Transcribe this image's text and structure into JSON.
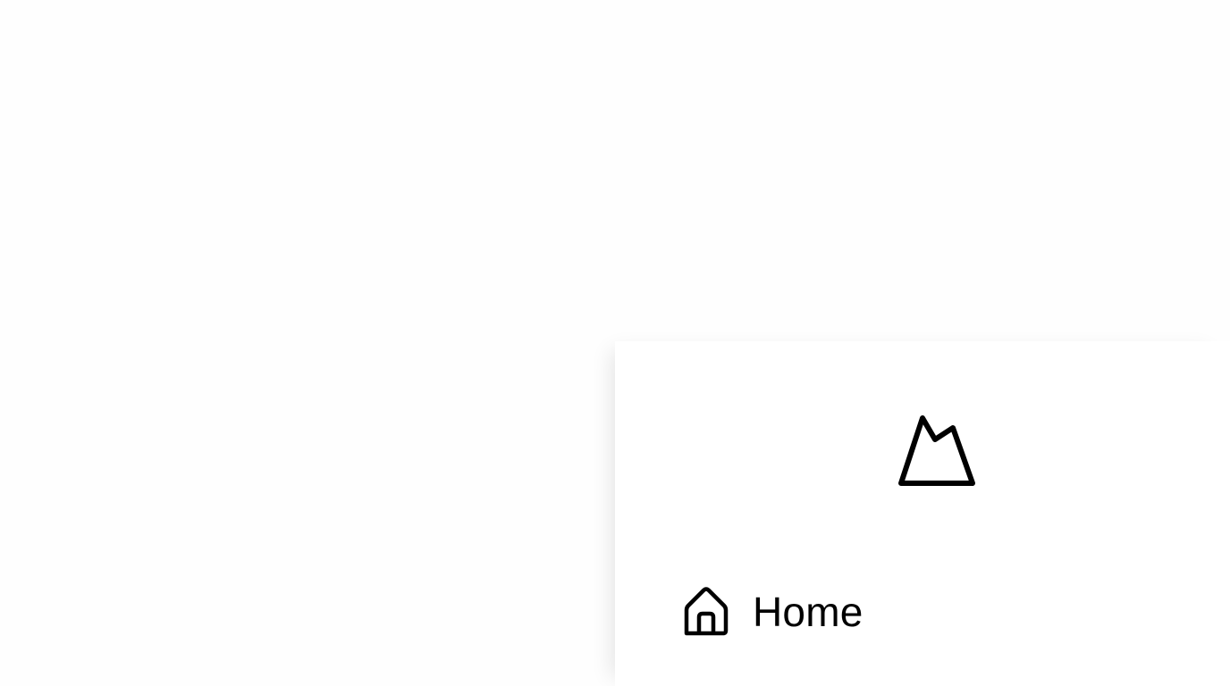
{
  "app": {
    "logo_icon": "mountain-logo-icon"
  },
  "nav": {
    "items": [
      {
        "label": "Home",
        "icon": "home-icon"
      }
    ]
  },
  "colors": {
    "background": "#fefefe",
    "panel": "#ffffff",
    "foreground": "#000000"
  }
}
